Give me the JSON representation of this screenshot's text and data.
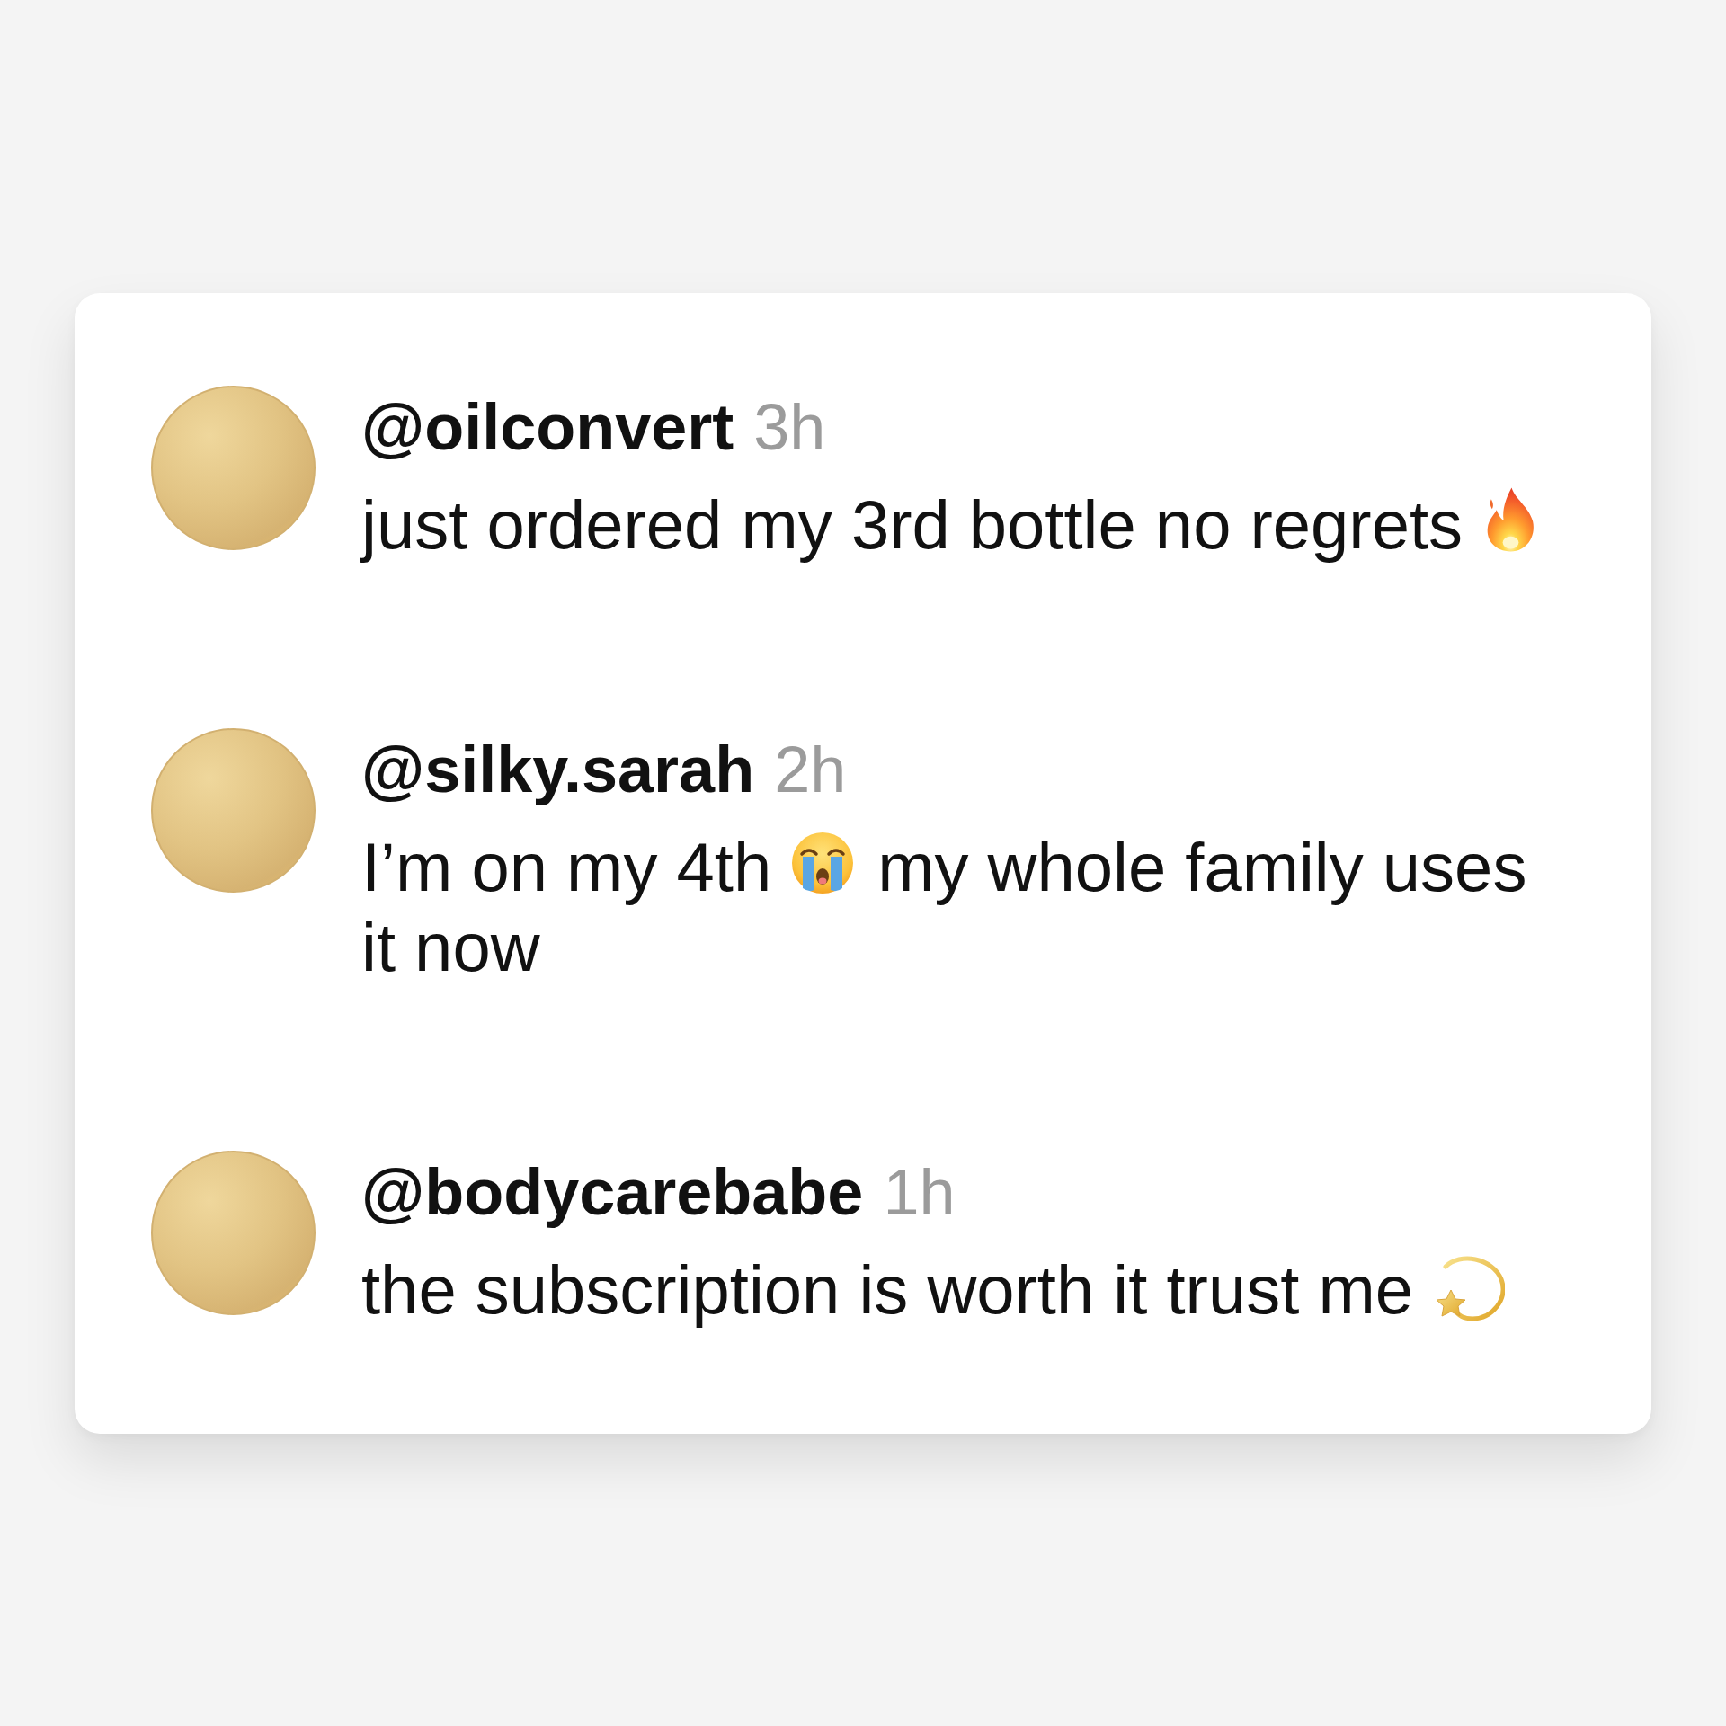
{
  "comments": [
    {
      "username": "@oilconvert",
      "time": "3h",
      "body": [
        {
          "kind": "text",
          "text": "just ordered my 3rd bottle no regrets"
        },
        {
          "kind": "emoji"
        }
      ]
    },
    {
      "username": "@silky.sarah",
      "time": "2h",
      "body": [
        {
          "kind": "text",
          "text": "I’m on my 4th"
        },
        {
          "kind": "emoji"
        },
        {
          "kind": "text",
          "text": "my whole family uses it now"
        }
      ]
    },
    {
      "username": "@bodycarebabe",
      "time": "1h",
      "body": [
        {
          "kind": "text",
          "text": "the subscription is worth it trust me"
        },
        {
          "kind": "emoji"
        }
      ]
    }
  ]
}
